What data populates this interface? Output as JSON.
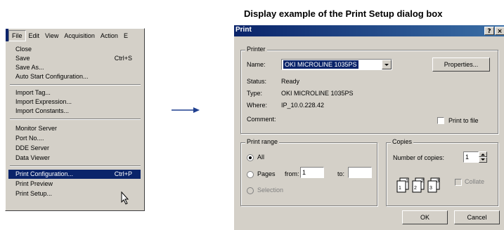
{
  "menu": {
    "bar": [
      "File",
      "Edit",
      "View",
      "Acquisition",
      "Action",
      "E"
    ],
    "items": [
      {
        "label": "Close",
        "shortcut": ""
      },
      {
        "label": "Save",
        "shortcut": "Ctrl+S"
      },
      {
        "label": "Save As...",
        "shortcut": ""
      },
      {
        "label": "Auto Start Configuration...",
        "shortcut": ""
      },
      {
        "label": "Import Tag...",
        "shortcut": ""
      },
      {
        "label": "Import Expression...",
        "shortcut": ""
      },
      {
        "label": "Import Constants...",
        "shortcut": ""
      },
      {
        "label": "Monitor Server",
        "shortcut": ""
      },
      {
        "label": "Port No....",
        "shortcut": ""
      },
      {
        "label": "DDE Server",
        "shortcut": ""
      },
      {
        "label": "Data Viewer",
        "shortcut": ""
      },
      {
        "label": "Print Configuration...",
        "shortcut": "Ctrl+P"
      },
      {
        "label": "Print Preview",
        "shortcut": ""
      },
      {
        "label": "Print Setup...",
        "shortcut": ""
      }
    ]
  },
  "caption": "Display example of the Print Setup dialog box",
  "dialog": {
    "title": "Print",
    "help_btn": "?",
    "close_btn": "×",
    "printer_group": "Printer",
    "name_label": "Name:",
    "name_value": "OKI MICROLINE 1035PS",
    "properties_btn": "Properties...",
    "status_label": "Status:",
    "status_value": "Ready",
    "type_label": "Type:",
    "type_value": "OKI MICROLINE 1035PS",
    "where_label": "Where:",
    "where_value": "IP_10.0.228.42",
    "comment_label": "Comment:",
    "print_to_file": "Print to file",
    "range_group": "Print range",
    "range_all": "All",
    "range_pages": "Pages",
    "from_label": "from:",
    "from_value": "1",
    "to_label": "to:",
    "to_value": "",
    "range_selection": "Selection",
    "copies_group": "Copies",
    "copies_label": "Number of copies:",
    "copies_value": "1",
    "collate": "Collate",
    "ok_btn": "OK",
    "cancel_btn": "Cancel"
  }
}
